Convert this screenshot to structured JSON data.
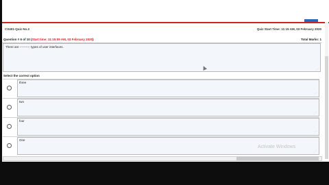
{
  "header": {
    "quiz_title": "CS401-Quiz No.2",
    "start_time": "Quiz Start Time: 11:15 AM, 03 February 2020"
  },
  "question": {
    "number_label": "Question # 6 of 10 (",
    "start_label": "Start time: 11:15:09 AM, 03 February 2020",
    "close_paren": ")",
    "total_marks": "Total Marks: 1",
    "text": "There are ---------- types of user interfaces."
  },
  "options": {
    "label": "Select the correct option",
    "items": [
      {
        "text": "three"
      },
      {
        "text": "two"
      },
      {
        "text": "four"
      },
      {
        "text": "One"
      }
    ]
  },
  "watermark": "Activate Windows"
}
